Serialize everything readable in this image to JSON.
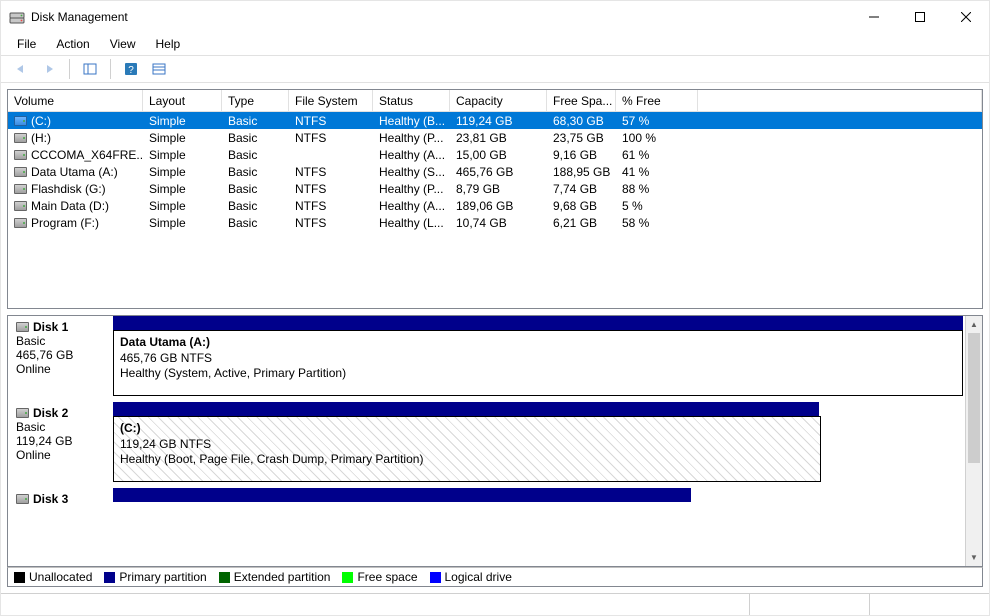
{
  "window": {
    "title": "Disk Management"
  },
  "menubar": [
    "File",
    "Action",
    "View",
    "Help"
  ],
  "columns": {
    "volume": "Volume",
    "layout": "Layout",
    "type": "Type",
    "fs": "File System",
    "status": "Status",
    "capacity": "Capacity",
    "free": "Free Spa...",
    "pct": "% Free"
  },
  "volumes": [
    {
      "name": " (C:)",
      "layout": "Simple",
      "type": "Basic",
      "fs": "NTFS",
      "status": "Healthy (B...",
      "capacity": "119,24 GB",
      "free": "68,30 GB",
      "pct": "57 %",
      "selected": true
    },
    {
      "name": " (H:)",
      "layout": "Simple",
      "type": "Basic",
      "fs": "NTFS",
      "status": "Healthy (P...",
      "capacity": "23,81 GB",
      "free": "23,75 GB",
      "pct": "100 %",
      "selected": false
    },
    {
      "name": "CCCOMA_X64FRE...",
      "layout": "Simple",
      "type": "Basic",
      "fs": "",
      "status": "Healthy (A...",
      "capacity": "15,00 GB",
      "free": "9,16 GB",
      "pct": "61 %",
      "selected": false
    },
    {
      "name": "Data Utama (A:)",
      "layout": "Simple",
      "type": "Basic",
      "fs": "NTFS",
      "status": "Healthy (S...",
      "capacity": "465,76 GB",
      "free": "188,95 GB",
      "pct": "41 %",
      "selected": false
    },
    {
      "name": "Flashdisk (G:)",
      "layout": "Simple",
      "type": "Basic",
      "fs": "NTFS",
      "status": "Healthy (P...",
      "capacity": "8,79 GB",
      "free": "7,74 GB",
      "pct": "88 %",
      "selected": false
    },
    {
      "name": "Main Data (D:)",
      "layout": "Simple",
      "type": "Basic",
      "fs": "NTFS",
      "status": "Healthy (A...",
      "capacity": "189,06 GB",
      "free": "9,68 GB",
      "pct": "5 %",
      "selected": false
    },
    {
      "name": "Program (F:)",
      "layout": "Simple",
      "type": "Basic",
      "fs": "NTFS",
      "status": "Healthy (L...",
      "capacity": "10,74 GB",
      "free": "6,21 GB",
      "pct": "58 %",
      "selected": false
    }
  ],
  "disks": [
    {
      "name": "Disk 1",
      "type": "Basic",
      "size": "465,76 GB",
      "state": "Online",
      "capWidth": "full",
      "partitions": [
        {
          "title": "Data Utama  (A:)",
          "line2": "465,76 GB NTFS",
          "line3": "Healthy (System, Active, Primary Partition)",
          "flex": 1,
          "hatched": false
        }
      ]
    },
    {
      "name": "Disk 2",
      "type": "Basic",
      "size": "119,24 GB",
      "state": "Online",
      "capWidth": "short",
      "partitions": [
        {
          "title": " (C:)",
          "line2": "119,24 GB NTFS",
          "line3": "Healthy (Boot, Page File, Crash Dump, Primary Partition)",
          "flex": 83,
          "hatched": true
        },
        {
          "title": "",
          "line2": "",
          "line3": "",
          "flex": 17,
          "hatched": false,
          "borderless": true
        }
      ]
    },
    {
      "name": "Disk 3",
      "type": "",
      "size": "",
      "state": "",
      "capWidth": "short2",
      "partitions": [],
      "truncated": true
    }
  ],
  "legend": [
    {
      "color": "#000000",
      "label": "Unallocated"
    },
    {
      "color": "#00008B",
      "label": "Primary partition"
    },
    {
      "color": "#006400",
      "label": "Extended partition"
    },
    {
      "color": "#00ff00",
      "label": "Free space"
    },
    {
      "color": "#0000ff",
      "label": "Logical drive"
    }
  ]
}
